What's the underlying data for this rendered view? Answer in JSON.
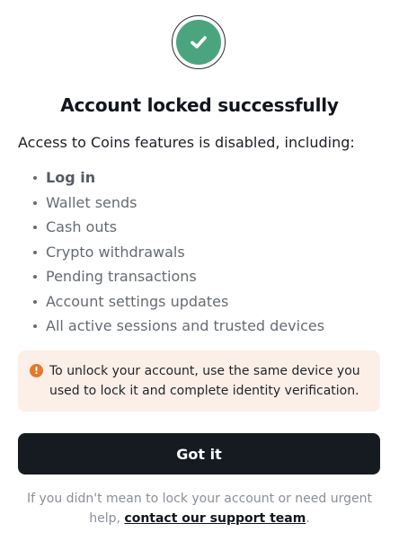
{
  "dialog": {
    "status_icon": "check-circle-icon",
    "title": "Account locked successfully",
    "intro": "Access to Coins features is disabled, including:",
    "features": [
      "Log in",
      "Wallet sends",
      "Cash outs",
      "Crypto withdrawals",
      "Pending transactions",
      "Account settings updates",
      "All active sessions and trusted devices"
    ],
    "notice": {
      "icon": "exclamation-circle-icon",
      "icon_glyph": "!",
      "text": "To unlock your account, use the same device you used to lock it and complete identity verification."
    },
    "primary_button": "Got it",
    "footer": {
      "prefix": "If you didn't mean to lock your account or need urgent help, ",
      "link": "contact our support team",
      "suffix": "."
    }
  },
  "colors": {
    "success_green": "#4aa57f",
    "button_dark": "#161b22",
    "notice_bg": "#fcefe8",
    "notice_icon": "#e6782b"
  }
}
